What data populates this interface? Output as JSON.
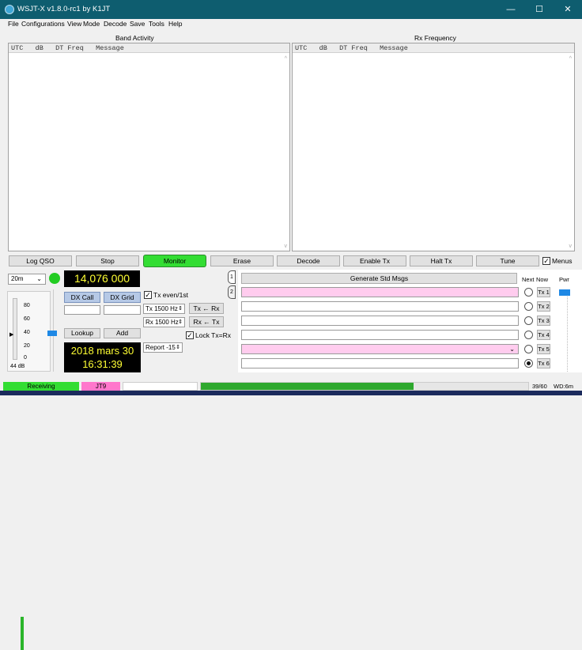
{
  "window": {
    "title": "WSJT-X   v1.8.0-rc1   by K1JT",
    "minimize": "—",
    "maximize": "☐",
    "close": "✕"
  },
  "menu": [
    "File",
    "Configurations",
    "View",
    "Mode",
    "Decode",
    "Save",
    "Tools",
    "Help"
  ],
  "band_activity": {
    "title": "Band Activity",
    "header": "UTC   dB   DT Freq   Message"
  },
  "rx_frequency": {
    "title": "Rx Frequency",
    "header": "UTC   dB   DT Freq   Message"
  },
  "buttons": {
    "log_qso": "Log QSO",
    "stop": "Stop",
    "monitor": "Monitor",
    "erase": "Erase",
    "decode": "Decode",
    "enable_tx": "Enable Tx",
    "halt_tx": "Halt Tx",
    "tune": "Tune",
    "menus": "Menus"
  },
  "band": {
    "selected": "20m"
  },
  "frequency": "14,076 000",
  "dx": {
    "call_label": "DX Call",
    "grid_label": "DX Grid",
    "lookup": "Lookup",
    "add": "Add"
  },
  "clock": {
    "date": "2018 mars 30",
    "time": "16:31:39"
  },
  "controls": {
    "tx_even": "Tx even/1st",
    "tx_freq": "Tx  1500  Hz",
    "tx_from_rx": "Tx ← Rx",
    "rx_freq": "Rx  1500  Hz",
    "rx_from_tx": "Rx ← Tx",
    "lock": "Lock Tx=Rx",
    "report": "Report -15"
  },
  "tabs": {
    "tab1": "1",
    "tab2": "2"
  },
  "messages": {
    "generate": "Generate Std Msgs",
    "next_label": "Next",
    "now_label": "Now",
    "pwr_label": "Pwr",
    "tx": [
      "Tx 1",
      "Tx 2",
      "Tx 3",
      "Tx 4",
      "Tx 5",
      "Tx 6"
    ]
  },
  "meter": {
    "ticks": [
      "80",
      "60",
      "40",
      "20",
      "0"
    ],
    "db": "44 dB",
    "level_db": 44
  },
  "status": {
    "receiving": "Receiving",
    "mode": "JT9",
    "progress": "39/60",
    "wd": "WD:6m"
  },
  "colors": {
    "titlebar": "#0e5d6f",
    "monitor": "#33dd33",
    "receiving": "#33dd33",
    "mode": "#ff77cc",
    "lcd_text": "#ffff33",
    "pink_msg": "#ffccee"
  }
}
